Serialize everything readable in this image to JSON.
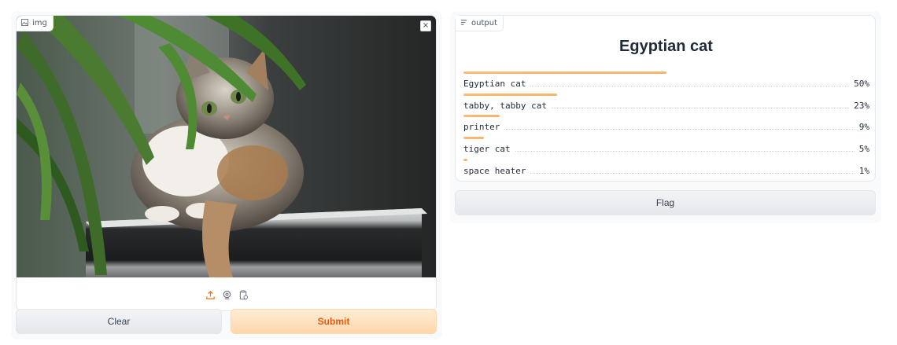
{
  "input": {
    "label": "img",
    "label_icon": "image-icon",
    "close_symbol": "×",
    "sources": [
      "upload-icon",
      "webcam-icon",
      "clipboard-icon"
    ]
  },
  "buttons": {
    "clear": "Clear",
    "submit": "Submit",
    "flag": "Flag"
  },
  "output": {
    "label": "output",
    "label_icon": "chart-icon",
    "top_label": "Egyptian cat",
    "confidences": [
      {
        "label": "Egyptian cat",
        "value_text": "50%",
        "fraction": 0.5
      },
      {
        "label": "tabby, tabby cat",
        "value_text": "23%",
        "fraction": 0.23
      },
      {
        "label": "printer",
        "value_text": "9%",
        "fraction": 0.09
      },
      {
        "label": "tiger cat",
        "value_text": "5%",
        "fraction": 0.05
      },
      {
        "label": "space heater",
        "value_text": "1%",
        "fraction": 0.01
      }
    ]
  },
  "colors": {
    "accent": "#f97316",
    "submit_text": "#ea580c",
    "bar": "#fdba74"
  }
}
